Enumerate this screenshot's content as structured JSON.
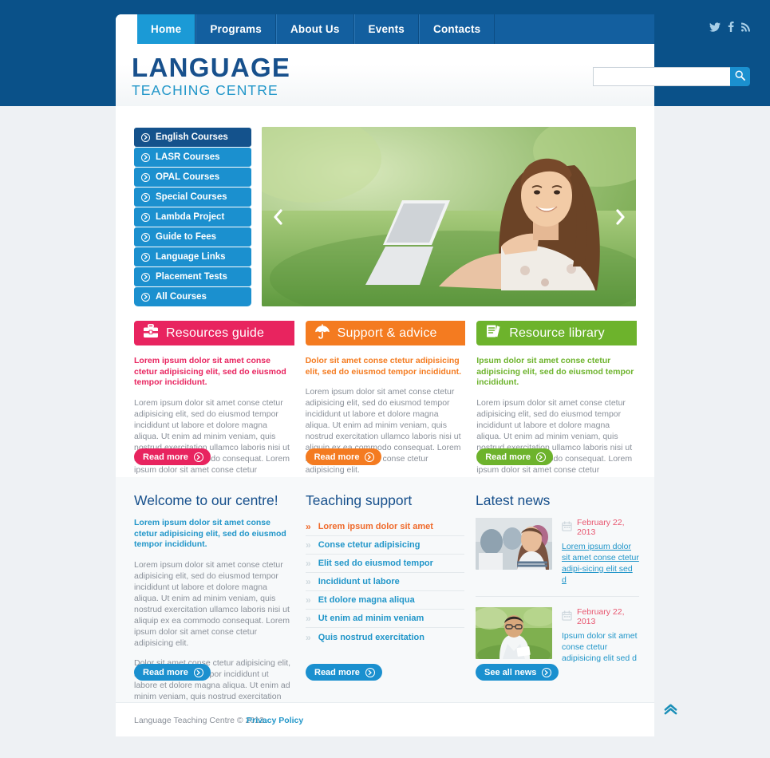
{
  "nav": {
    "items": [
      {
        "label": "Home",
        "active": true
      },
      {
        "label": "Programs",
        "active": false
      },
      {
        "label": "About Us",
        "active": false
      },
      {
        "label": "Events",
        "active": false
      },
      {
        "label": "Contacts",
        "active": false
      }
    ],
    "social": [
      "twitter-icon",
      "facebook-icon",
      "rss-icon"
    ]
  },
  "logo": {
    "main": "LANGUAGE",
    "sub": "TEACHING CENTRE"
  },
  "search": {
    "value": "",
    "placeholder": "",
    "button_icon": "search-icon"
  },
  "sidemenu": {
    "items": [
      {
        "label": "English Courses",
        "active": true
      },
      {
        "label": "LASR Courses",
        "active": false
      },
      {
        "label": "OPAL Courses",
        "active": false
      },
      {
        "label": "Special Courses",
        "active": false
      },
      {
        "label": "Lambda Project",
        "active": false
      },
      {
        "label": "Guide to Fees",
        "active": false
      },
      {
        "label": "Language Links",
        "active": false
      },
      {
        "label": "Placement Tests",
        "active": false
      },
      {
        "label": "All Courses",
        "active": false
      }
    ]
  },
  "slider": {
    "prev_icon": "chevron-left-icon",
    "next_icon": "chevron-right-icon",
    "alt": "Smiling woman lying on grass using a laptop"
  },
  "cards": [
    {
      "title": "Resources guide",
      "icon": "briefcase-icon",
      "color": "#e8245f",
      "lead": "Lorem ipsum dolor sit amet conse ctetur adipisicing elit, sed do eiusmod tempor incididunt.",
      "body": "Lorem ipsum dolor sit amet conse ctetur adipisicing elit, sed do eiusmod tempor incididunt ut labore et dolore magna aliqua. Ut enim ad minim veniam, quis nostrud exercitation ullamco laboris nisi ut aliquip ex ea commodo consequat. Lorem ipsum dolor sit amet conse ctetur adipisicing elit.",
      "button": "Read more"
    },
    {
      "title": "Support & advice",
      "icon": "umbrella-icon",
      "color": "#f47b20",
      "lead": "Dolor sit amet conse ctetur adipisicing elit, sed do eiusmod tempor incididunt.",
      "body": "Lorem ipsum dolor sit amet conse ctetur adipisicing elit, sed do eiusmod tempor incididunt ut labore et dolore magna aliqua. Ut enim ad minim veniam, quis nostrud exercitation ullamco laboris nisi ut aliquip ex ea commodo consequat. Lorem ipsum dolor sit amet conse ctetur adipisicing elit.",
      "button": "Read more"
    },
    {
      "title": "Resource library",
      "icon": "book-icon",
      "color": "#6db32c",
      "lead": "Ipsum dolor sit amet conse ctetur adipisicing elit, sed do eiusmod tempor incididunt.",
      "body": "Lorem ipsum dolor sit amet conse ctetur adipisicing elit, sed do eiusmod tempor incididunt ut labore et dolore magna aliqua. Ut enim ad minim veniam, quis nostrud exercitation ullamco laboris nisi ut aliquip ex ea commodo consequat. Lorem ipsum dolor sit amet conse ctetur adipisicing elit.",
      "button": "Read more"
    }
  ],
  "welcome": {
    "title": "Welcome to our centre!",
    "lead": "Lorem ipsum dolor sit amet conse ctetur adipisicing elit, sed do eiusmod tempor incididunt.",
    "p1": "Lorem ipsum dolor sit amet conse ctetur adipisicing elit, sed do eiusmod tempor incididunt ut labore et dolore magna aliqua. Ut enim ad minim veniam, quis nostrud exercitation ullamco laboris nisi ut aliquip ex ea commodo consequat. Lorem ipsum dolor sit amet conse ctetur adipisicing elit.",
    "p2": "Dolor sit amet conse ctetur adipisicing elit, sed do eiusmod tempor incididunt ut labore et dolore magna aliqua. Ut enim ad minim veniam, quis nostrud exercitation ullamco laboris nisi ut aliquip ex ea commodo consequat. Lorem ipsum dolor sit amet conse ctetur adipisicing elit.",
    "button": "Read more"
  },
  "teaching": {
    "title": "Teaching support",
    "items": [
      {
        "label": "Lorem ipsum dolor sit amet",
        "highlight": true
      },
      {
        "label": "Conse ctetur adipisicing",
        "highlight": false
      },
      {
        "label": "Elit sed do eiusmod tempor",
        "highlight": false
      },
      {
        "label": "Incididunt ut labore",
        "highlight": false
      },
      {
        "label": "Et dolore magna aliqua",
        "highlight": false
      },
      {
        "label": "Ut enim ad minim veniam",
        "highlight": false
      },
      {
        "label": "Quis nostrud exercitation",
        "highlight": false
      }
    ],
    "button": "Read more"
  },
  "news": {
    "title": "Latest news",
    "items": [
      {
        "date": "February 22, 2013",
        "date_icon": "calendar-icon",
        "text": "Lorem ipsum dolor sit amet conse ctetur adipi-sicing elit sed d",
        "underlined": true,
        "thumb_alt": "Students in a classroom"
      },
      {
        "date": "February 22, 2013",
        "date_icon": "calendar-icon",
        "text": "Ipsum dolor sit amet conse ctetur adipisicing elit sed d",
        "underlined": false,
        "thumb_alt": "Man with glasses sitting on grass"
      }
    ],
    "button": "See all news"
  },
  "footer": {
    "copyright": "Language Teaching Centre © 2013.",
    "privacy": "Privacy Policy",
    "to_top_icon": "chevron-double-up-icon"
  },
  "colors": {
    "navy": "#0a5189",
    "blue": "#1b90cf",
    "nav_dark": "#135f9f",
    "pink": "#e8245f",
    "orange": "#f47b20",
    "green": "#6db32c",
    "teal": "#2196c9",
    "heading": "#17508c"
  }
}
